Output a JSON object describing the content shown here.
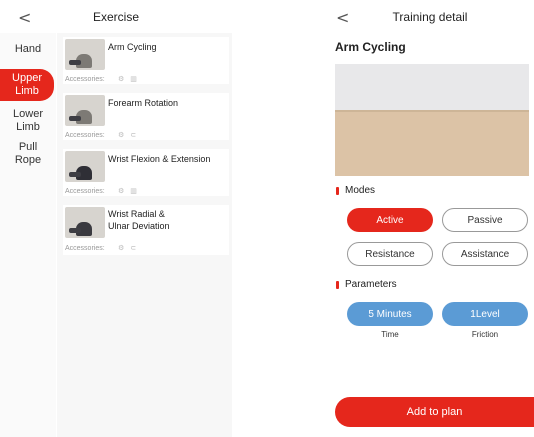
{
  "left": {
    "title": "Exercise",
    "back_glyph": "<",
    "categories": [
      "Hand",
      "Upper Limb",
      "Lower Limb",
      "Pull Rope"
    ],
    "exercises": [
      {
        "name": "Arm Cycling",
        "accessories_label": "Accessories:",
        "acc_icons": "⚙ ▥"
      },
      {
        "name": "Forearm Rotation",
        "accessories_label": "Accessories:",
        "acc_icons": "⚙ ⊂"
      },
      {
        "name": "Wrist Flexion & Extension",
        "accessories_label": "Accessories:",
        "acc_icons": "⚙ ▥"
      },
      {
        "name": "Wrist Radial & Ulnar Deviation",
        "accessories_label": "Accessories:",
        "acc_icons": "⚙ ⊂"
      }
    ]
  },
  "right": {
    "title": "Training detail",
    "back_glyph": "<",
    "exercise_name": "Arm Cycling",
    "modes_label": "Modes",
    "modes": [
      "Active",
      "Passive",
      "Resistance",
      "Assistance"
    ],
    "selected_mode": "Active",
    "parameters_label": "Parameters",
    "params": [
      {
        "value": "5 Minutes",
        "label": "Time"
      },
      {
        "value": "1Level",
        "label": "Friction"
      }
    ],
    "add_button": "Add to plan"
  },
  "colors": {
    "accent": "#e5271c",
    "param_blue": "#5b9bd5"
  }
}
